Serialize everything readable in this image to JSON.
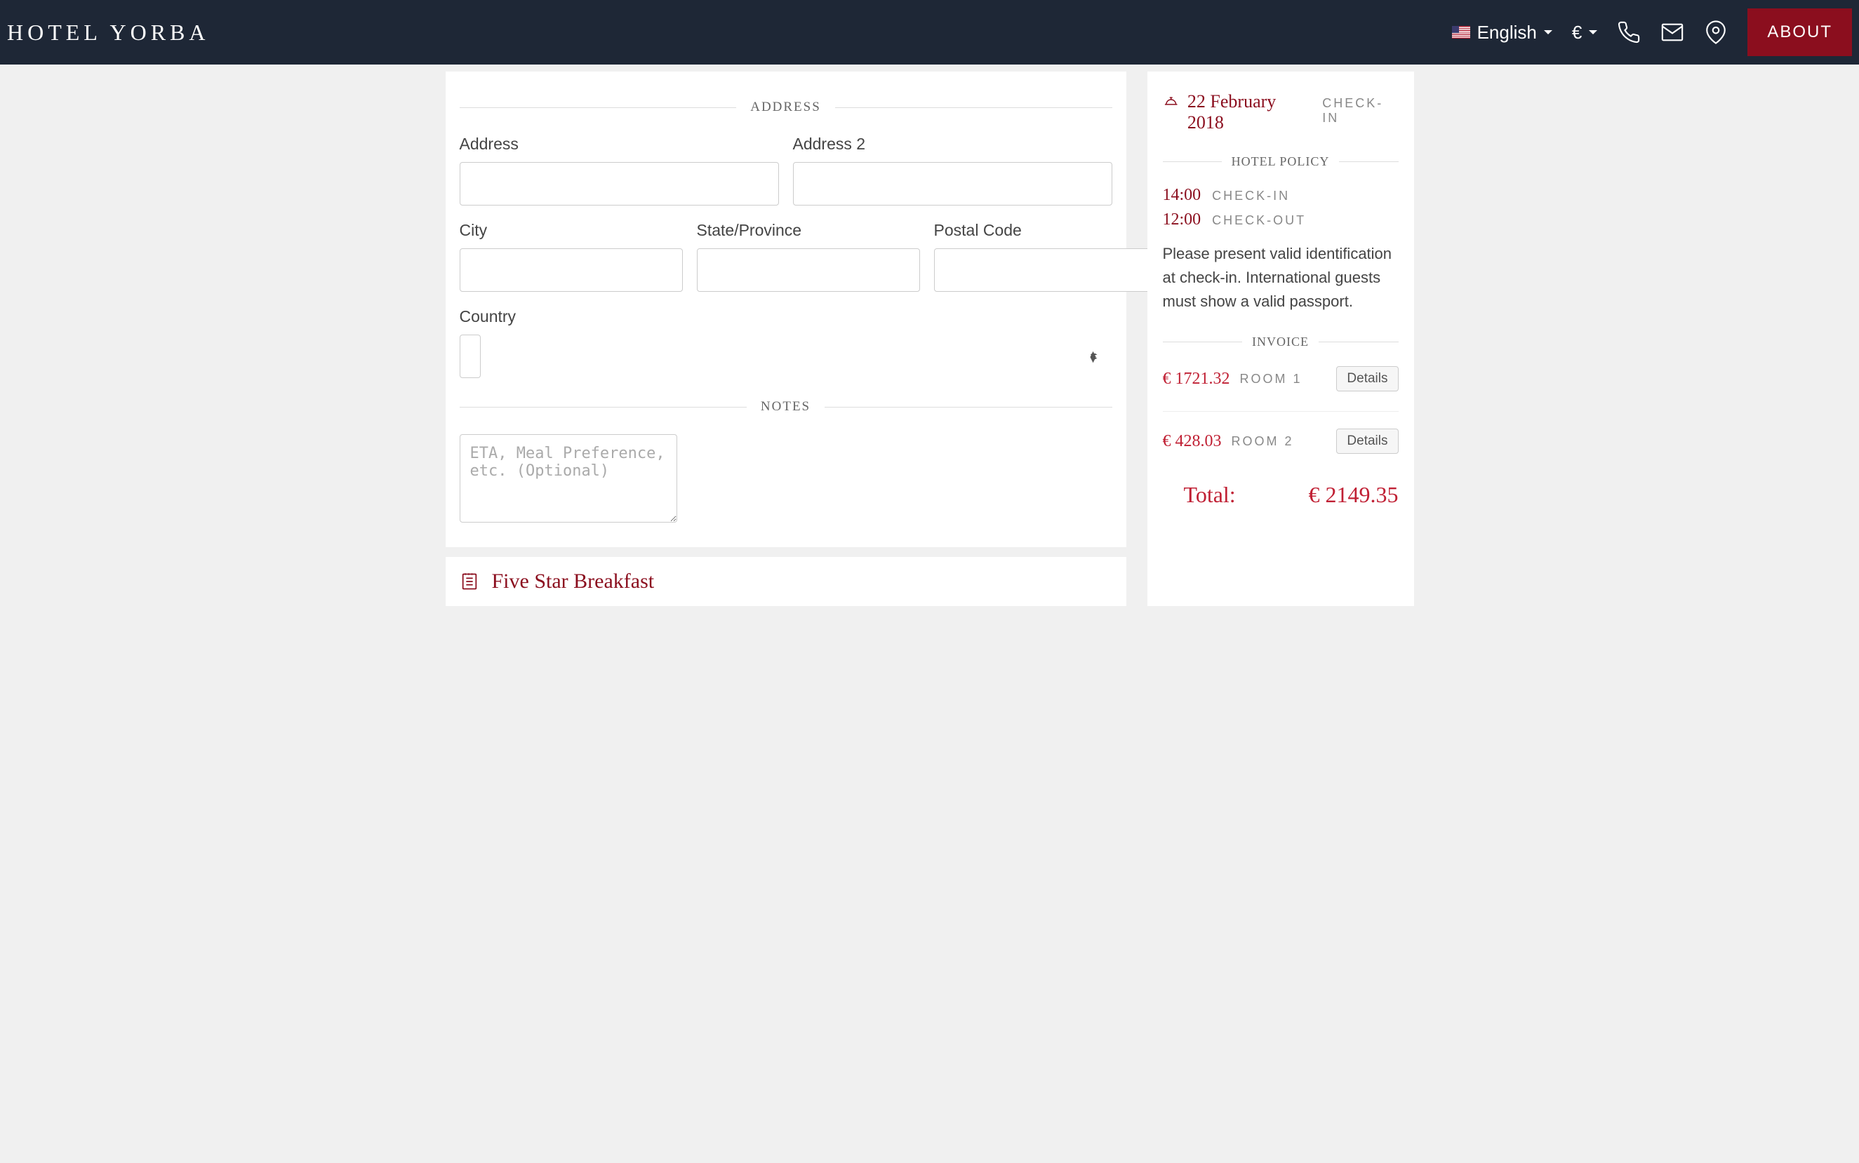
{
  "header": {
    "brand": "HOTEL YORBA",
    "language": "English",
    "currency": "€",
    "about": "ABOUT"
  },
  "form": {
    "address_section": "ADDRESS",
    "address_label": "Address",
    "address2_label": "Address 2",
    "city_label": "City",
    "state_label": "State/Province",
    "postal_label": "Postal Code",
    "country_label": "Country",
    "notes_section": "NOTES",
    "notes_placeholder": "ETA, Meal Preference, etc. (Optional)"
  },
  "breakfast": {
    "title": "Five Star Breakfast"
  },
  "sidebar": {
    "checkin_date": "22 February 2018",
    "checkin_label": "CHECK-IN",
    "policy_title": "HOTEL POLICY",
    "checkin_time": "14:00",
    "checkin_time_label": "CHECK-IN",
    "checkout_time": "12:00",
    "checkout_time_label": "CHECK-OUT",
    "policy_text": "Please present valid identification at check-in. International guests must show a valid passport.",
    "invoice_title": "INVOICE",
    "rooms": [
      {
        "price": "€ 1721.32",
        "label": "ROOM 1",
        "button": "Details"
      },
      {
        "price": "€ 428.03",
        "label": "ROOM 2",
        "button": "Details"
      }
    ],
    "total_label": "Total:",
    "total_value": "€ 2149.35"
  }
}
